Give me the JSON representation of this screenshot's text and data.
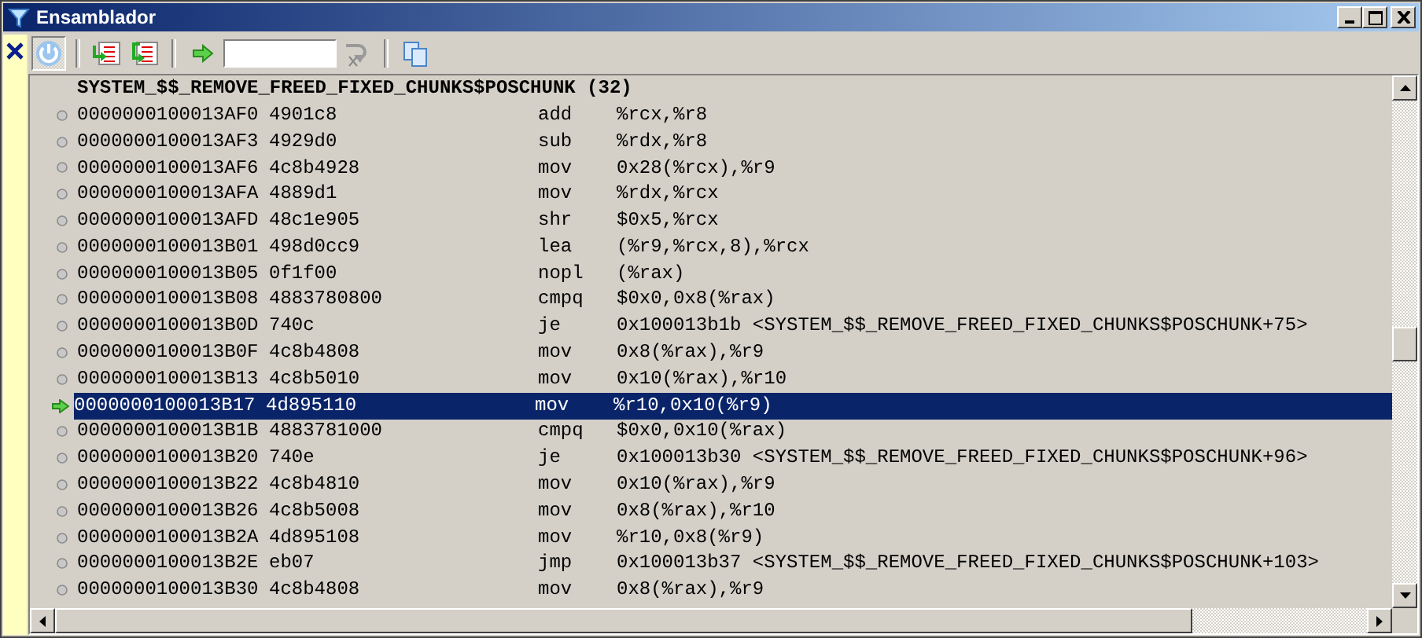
{
  "window": {
    "title": "Ensamblador"
  },
  "toolbar": {
    "power_pressed": true
  },
  "listing": {
    "header": "SYSTEM_$$_REMOVE_FREED_FIXED_CHUNKS$POSCHUNK (32)",
    "rows": [
      {
        "address": "0000000100013AF0",
        "bytes": "4901c8",
        "mnemonic": "add",
        "operands": "%rcx,%r8",
        "current": false,
        "selected": false
      },
      {
        "address": "0000000100013AF3",
        "bytes": "4929d0",
        "mnemonic": "sub",
        "operands": "%rdx,%r8",
        "current": false,
        "selected": false
      },
      {
        "address": "0000000100013AF6",
        "bytes": "4c8b4928",
        "mnemonic": "mov",
        "operands": "0x28(%rcx),%r9",
        "current": false,
        "selected": false
      },
      {
        "address": "0000000100013AFA",
        "bytes": "4889d1",
        "mnemonic": "mov",
        "operands": "%rdx,%rcx",
        "current": false,
        "selected": false
      },
      {
        "address": "0000000100013AFD",
        "bytes": "48c1e905",
        "mnemonic": "shr",
        "operands": "$0x5,%rcx",
        "current": false,
        "selected": false
      },
      {
        "address": "0000000100013B01",
        "bytes": "498d0cc9",
        "mnemonic": "lea",
        "operands": "(%r9,%rcx,8),%rcx",
        "current": false,
        "selected": false
      },
      {
        "address": "0000000100013B05",
        "bytes": "0f1f00",
        "mnemonic": "nopl",
        "operands": "(%rax)",
        "current": false,
        "selected": false
      },
      {
        "address": "0000000100013B08",
        "bytes": "4883780800",
        "mnemonic": "cmpq",
        "operands": "$0x0,0x8(%rax)",
        "current": false,
        "selected": false
      },
      {
        "address": "0000000100013B0D",
        "bytes": "740c",
        "mnemonic": "je",
        "operands": "0x100013b1b <SYSTEM_$$_REMOVE_FREED_FIXED_CHUNKS$POSCHUNK+75>",
        "current": false,
        "selected": false
      },
      {
        "address": "0000000100013B0F",
        "bytes": "4c8b4808",
        "mnemonic": "mov",
        "operands": "0x8(%rax),%r9",
        "current": false,
        "selected": false
      },
      {
        "address": "0000000100013B13",
        "bytes": "4c8b5010",
        "mnemonic": "mov",
        "operands": "0x10(%rax),%r10",
        "current": false,
        "selected": false
      },
      {
        "address": "0000000100013B17",
        "bytes": "4d895110",
        "mnemonic": "mov",
        "operands": "%r10,0x10(%r9)",
        "current": true,
        "selected": true
      },
      {
        "address": "0000000100013B1B",
        "bytes": "4883781000",
        "mnemonic": "cmpq",
        "operands": "$0x0,0x10(%rax)",
        "current": false,
        "selected": false
      },
      {
        "address": "0000000100013B20",
        "bytes": "740e",
        "mnemonic": "je",
        "operands": "0x100013b30 <SYSTEM_$$_REMOVE_FREED_FIXED_CHUNKS$POSCHUNK+96>",
        "current": false,
        "selected": false
      },
      {
        "address": "0000000100013B22",
        "bytes": "4c8b4810",
        "mnemonic": "mov",
        "operands": "0x10(%rax),%r9",
        "current": false,
        "selected": false
      },
      {
        "address": "0000000100013B26",
        "bytes": "4c8b5008",
        "mnemonic": "mov",
        "operands": "0x8(%rax),%r10",
        "current": false,
        "selected": false
      },
      {
        "address": "0000000100013B2A",
        "bytes": "4d895108",
        "mnemonic": "mov",
        "operands": "%r10,0x8(%r9)",
        "current": false,
        "selected": false
      },
      {
        "address": "0000000100013B2E",
        "bytes": "eb07",
        "mnemonic": "jmp",
        "operands": "0x100013b37 <SYSTEM_$$_REMOVE_FREED_FIXED_CHUNKS$POSCHUNK+103>",
        "current": false,
        "selected": false
      },
      {
        "address": "0000000100013B30",
        "bytes": "4c8b4808",
        "mnemonic": "mov",
        "operands": "0x8(%rax),%r9",
        "current": false,
        "selected": false
      }
    ]
  }
}
